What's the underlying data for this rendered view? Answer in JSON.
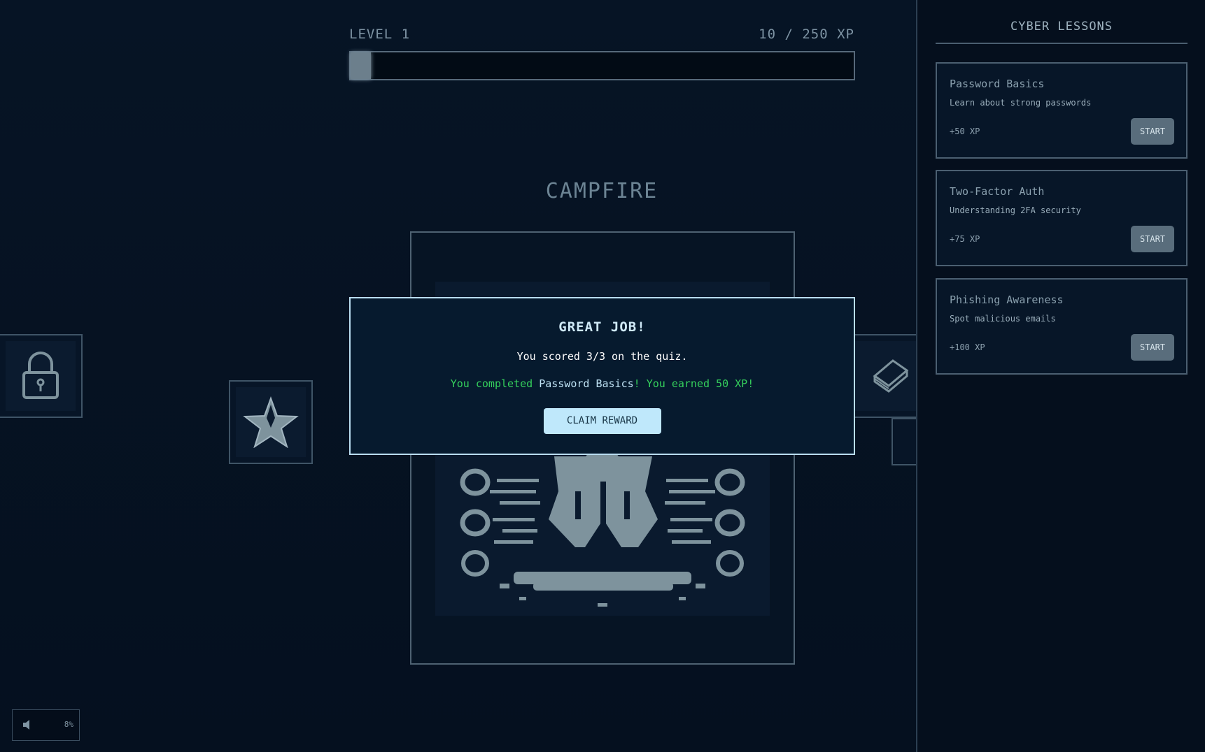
{
  "header": {
    "level": "LEVEL 1",
    "xp": "10 / 250 XP",
    "xp_current": 10,
    "xp_max": 250
  },
  "scene": {
    "title": "CAMPFIRE"
  },
  "modal": {
    "title": "GREAT JOB!",
    "score": "You scored 3/3 on the quiz.",
    "completed_prefix": "You completed ",
    "lesson_name": "Password Basics",
    "completed_suffix": "! You earned 50 XP!",
    "claim_label": "CLAIM REWARD"
  },
  "sidebar": {
    "title": "CYBER LESSONS",
    "lessons": [
      {
        "title": "Password Basics",
        "desc": "Learn about strong passwords",
        "xp": "+50 XP",
        "button": "START"
      },
      {
        "title": "Two-Factor Auth",
        "desc": "Understanding 2FA security",
        "xp": "+75 XP",
        "button": "START"
      },
      {
        "title": "Phishing Awareness",
        "desc": "Spot malicious emails",
        "xp": "+100 XP",
        "button": "START"
      }
    ]
  },
  "volume": {
    "value": "8%"
  },
  "colors": {
    "accent": "#bfe8fb",
    "success": "#35d05c",
    "panel_border": "#4b5f71"
  }
}
